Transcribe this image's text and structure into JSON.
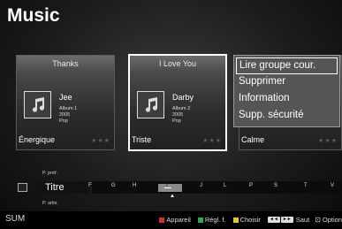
{
  "page": {
    "title": "Music"
  },
  "cards": [
    {
      "song": "Thanks",
      "artist": "Jee",
      "album": "Album 1",
      "year": "2005",
      "genre": "Pop",
      "mood": "Énergique",
      "stars": "★★★",
      "selected": false
    },
    {
      "song": "I Love You",
      "artist": "Darby",
      "album": "Album 2",
      "year": "2005",
      "genre": "Pop",
      "mood": "Triste",
      "stars": "★★★",
      "selected": true
    },
    {
      "mood": "Calme",
      "stars": "★★★"
    }
  ],
  "context_menu": {
    "items": [
      {
        "label": "Lire groupe cour.",
        "active": true
      },
      {
        "label": "Supprimer",
        "active": false
      },
      {
        "label": "Information",
        "active": false
      },
      {
        "label": "Supp. sécurité",
        "active": false
      }
    ]
  },
  "sort_nav": {
    "prev_label": "P. préf.",
    "current_label": "Titre",
    "next_label": "P. artis.",
    "letters": [
      "F",
      "G",
      "H",
      "I",
      "J",
      "L",
      "P",
      "S",
      "T",
      "V"
    ],
    "highlighted_letter": "I"
  },
  "bottom_bar": {
    "device": "SUM",
    "hints": [
      {
        "color": "#d92b2b",
        "icon": "red-square",
        "label": "Appareil"
      },
      {
        "color": "#2fa84a",
        "icon": "green-square",
        "label": "Régl. f."
      },
      {
        "color": "#e6c52e",
        "icon": "yellow-square",
        "label": "Choisir"
      },
      {
        "icon": "skip-keys",
        "keys": [
          "◄◄",
          "►►"
        ],
        "label": "Saut"
      },
      {
        "icon": "tools-icon",
        "label": "Option"
      }
    ]
  },
  "colors": {
    "highlight_border": "#ffffff",
    "menu_bg": "#555555"
  }
}
